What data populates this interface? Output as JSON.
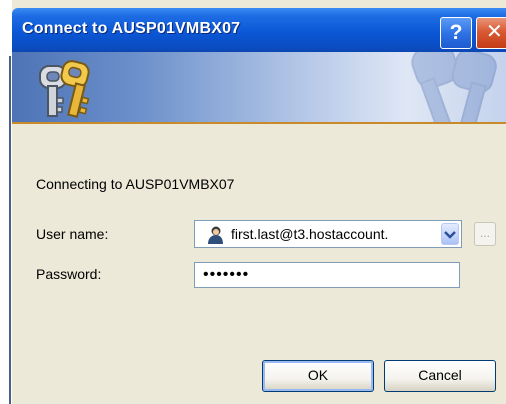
{
  "window": {
    "title": "Connect to AUSP01VMBX07",
    "help_label": "?",
    "close_label": "✕"
  },
  "banner": {
    "icon": "keys-icon"
  },
  "body": {
    "connecting_text": "Connecting to AUSP01VMBX07",
    "username_label": "User name:",
    "username_value": "first.last@t3.hostaccount.",
    "password_label": "Password:",
    "password_value": "•••••••",
    "browse_label": "..."
  },
  "buttons": {
    "ok_label": "OK",
    "cancel_label": "Cancel"
  },
  "colors": {
    "titlebar": "#0b57d6",
    "dialog_bg": "#ece9d8",
    "close_button": "#d85a35"
  }
}
